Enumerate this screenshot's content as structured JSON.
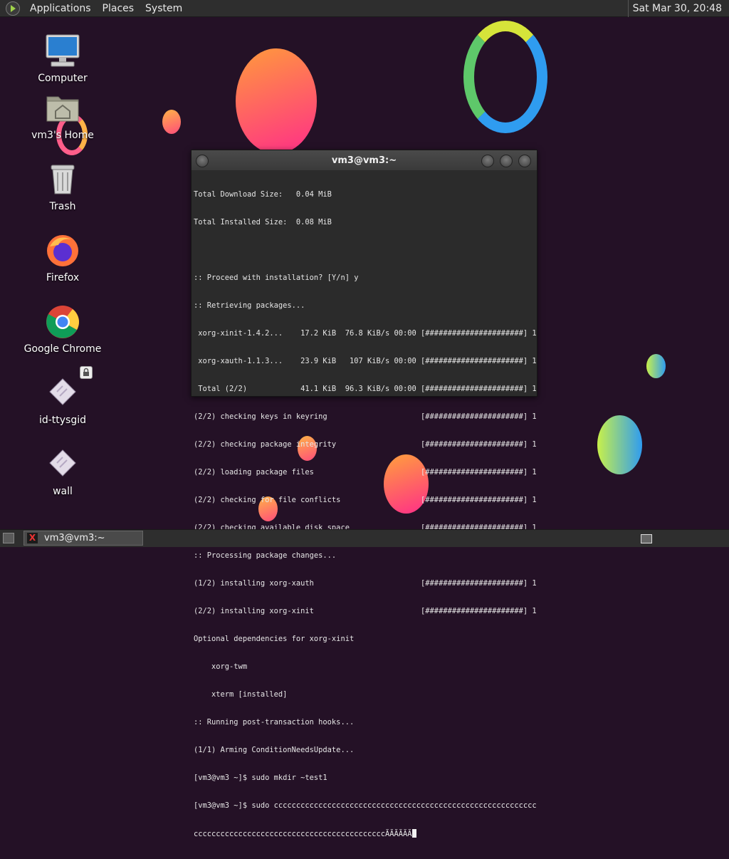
{
  "top_panel": {
    "menus": [
      "Applications",
      "Places",
      "System"
    ],
    "clock": "Sat Mar 30, 20:48"
  },
  "desktop_icons": [
    {
      "label": "Computer",
      "icon": "computer-icon"
    },
    {
      "label": "vm3's Home",
      "icon": "home-folder-icon"
    },
    {
      "label": "Trash",
      "icon": "trash-icon"
    },
    {
      "label": "Firefox",
      "icon": "firefox-icon"
    },
    {
      "label": "Google Chrome",
      "icon": "chrome-icon"
    },
    {
      "label": "id-ttysgid",
      "icon": "file-icon"
    },
    {
      "label": "wall",
      "icon": "file-icon"
    }
  ],
  "terminal": {
    "title": "vm3@vm3:~",
    "lines": [
      "Total Download Size:   0.04 MiB",
      "Total Installed Size:  0.08 MiB",
      "",
      ":: Proceed with installation? [Y/n] y",
      ":: Retrieving packages...",
      " xorg-xinit-1.4.2...    17.2 KiB  76.8 KiB/s 00:00 [######################] 100%",
      " xorg-xauth-1.1.3...    23.9 KiB   107 KiB/s 00:00 [######################] 100%",
      " Total (2/2)            41.1 KiB  96.3 KiB/s 00:00 [######################] 100%",
      "(2/2) checking keys in keyring                     [######################] 100%",
      "(2/2) checking package integrity                   [######################] 100%",
      "(2/2) loading package files                        [######################] 100%",
      "(2/2) checking for file conflicts                  [######################] 100%",
      "(2/2) checking available disk space                [######################] 100%",
      ":: Processing package changes...",
      "(1/2) installing xorg-xauth                        [######################] 100%",
      "(2/2) installing xorg-xinit                        [######################] 100%",
      "Optional dependencies for xorg-xinit",
      "    xorg-twm",
      "    xterm [installed]",
      ":: Running post-transaction hooks...",
      "(1/1) Arming ConditionNeedsUpdate...",
      "[vm3@vm3 ~]$ sudo mkdir ~test1",
      "[vm3@vm3 ~]$ sudo cccccccccccccccccccccccccccccccccccccccccccccccccccccccccccc",
      "cccccccccccccccccccccccccccccccccccccccccccÃÃÃÃÃÃ"
    ]
  },
  "taskbar": {
    "window_label": "vm3@vm3:~",
    "window_icon_glyph": "X"
  },
  "colors": {
    "background": "#241126",
    "panel": "#2e2e2e",
    "terminal_bg": "#2b2b2b"
  }
}
